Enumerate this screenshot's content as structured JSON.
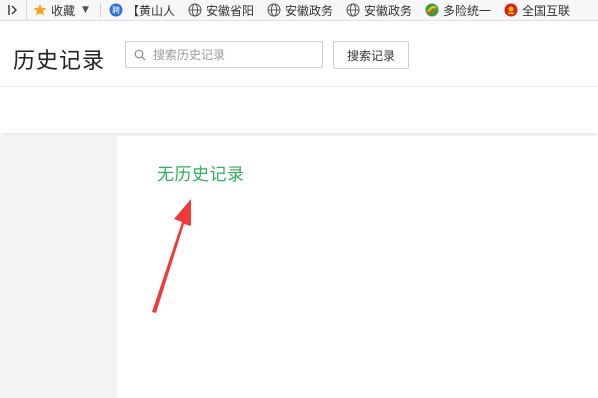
{
  "bookmarks": {
    "items": [
      {
        "label": "收藏",
        "icon": "star-icon"
      },
      {
        "label": "【黄山人",
        "icon": "app-icon"
      },
      {
        "label": "安徽省阳",
        "icon": "globe-icon"
      },
      {
        "label": "安徽政务",
        "icon": "globe-icon"
      },
      {
        "label": "安徽政务",
        "icon": "globe-icon"
      },
      {
        "label": "多险统一",
        "icon": "colorful-logo-icon"
      },
      {
        "label": "全国互联",
        "icon": "emblem-icon"
      }
    ]
  },
  "header": {
    "title": "历史记录",
    "search_placeholder": "搜索历史记录",
    "search_button": "搜索记录"
  },
  "main": {
    "empty_message": "无历史记录"
  },
  "colors": {
    "accent_green": "#2eaf59",
    "arrow_red": "#f03a3a",
    "star_orange": "#f5a623"
  }
}
